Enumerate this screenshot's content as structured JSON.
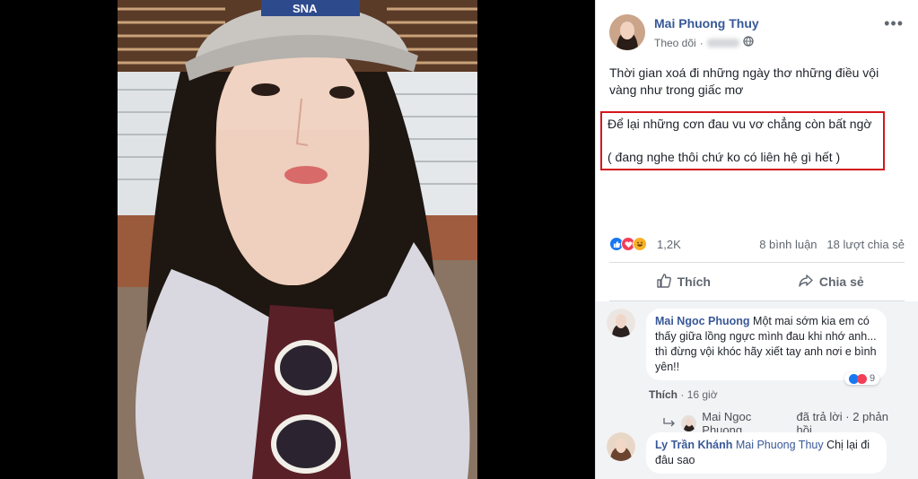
{
  "post": {
    "author": "Mai Phuong Thuy",
    "follow_label": "Theo dõi",
    "more_icon": "more-horizontal-icon",
    "privacy_icon": "globe-icon",
    "text_line1": "Thời gian xoá đi những ngày thơ những điều vội vàng như trong giấc mơ",
    "text_line2": "Để lại những cơn đau vu vơ chẳng còn bất ngờ",
    "text_line3": "( đang nghe thôi chứ ko có liên hệ gì hết )",
    "highlight_color": "#d3181e"
  },
  "stats": {
    "reaction_count": "1,2K",
    "comments": "8 bình luận",
    "shares": "18 lượt chia sẻ"
  },
  "actions": {
    "like": "Thích",
    "share": "Chia sẻ"
  },
  "comments": [
    {
      "name": "Mai Ngoc Phuong",
      "text": "Một mai sớm kia em có thấy giữa lồng ngực mình đau khi nhớ anh... thì đừng vội khóc hãy xiết tay anh nơi e bình yên!!",
      "like_label": "Thích",
      "time": "16 giờ",
      "reactions": "9",
      "reply_author": "Mai Ngoc Phuong",
      "reply_summary": "đã trả lời · 2 phản hồi"
    },
    {
      "name": "Ly Trần Khánh",
      "mention": "Mai Phuong Thuy",
      "text": "Chị lại đi đâu sao"
    }
  ]
}
